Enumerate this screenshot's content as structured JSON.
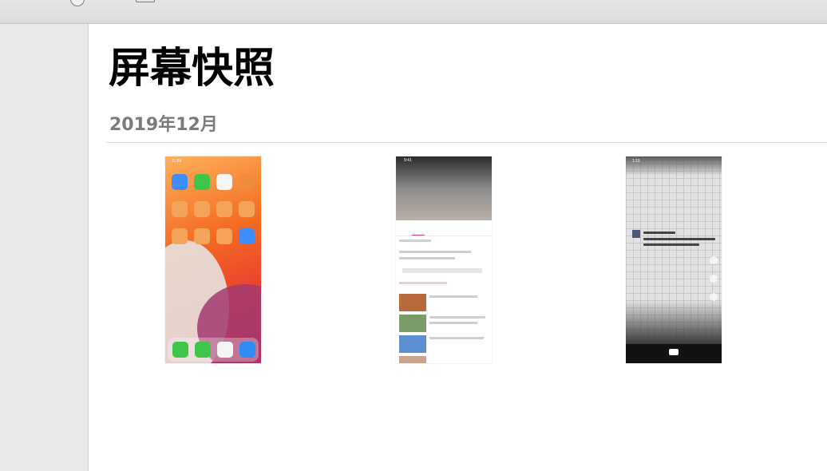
{
  "page": {
    "title": "屏幕快照",
    "section_header": "2019年12月"
  },
  "thumbnails": [
    {
      "label": "iPhone home screen screenshot",
      "status_time": "11:59"
    },
    {
      "label": "video app screenshot",
      "status_time": "9:41"
    },
    {
      "label": "short video app screenshot",
      "status_time": "1:15"
    }
  ],
  "colors": {
    "toolbar": "#e0e0e0",
    "sidebar": "#e9e9e9",
    "section_header": "#7b7b7b",
    "divider": "#dedede"
  }
}
